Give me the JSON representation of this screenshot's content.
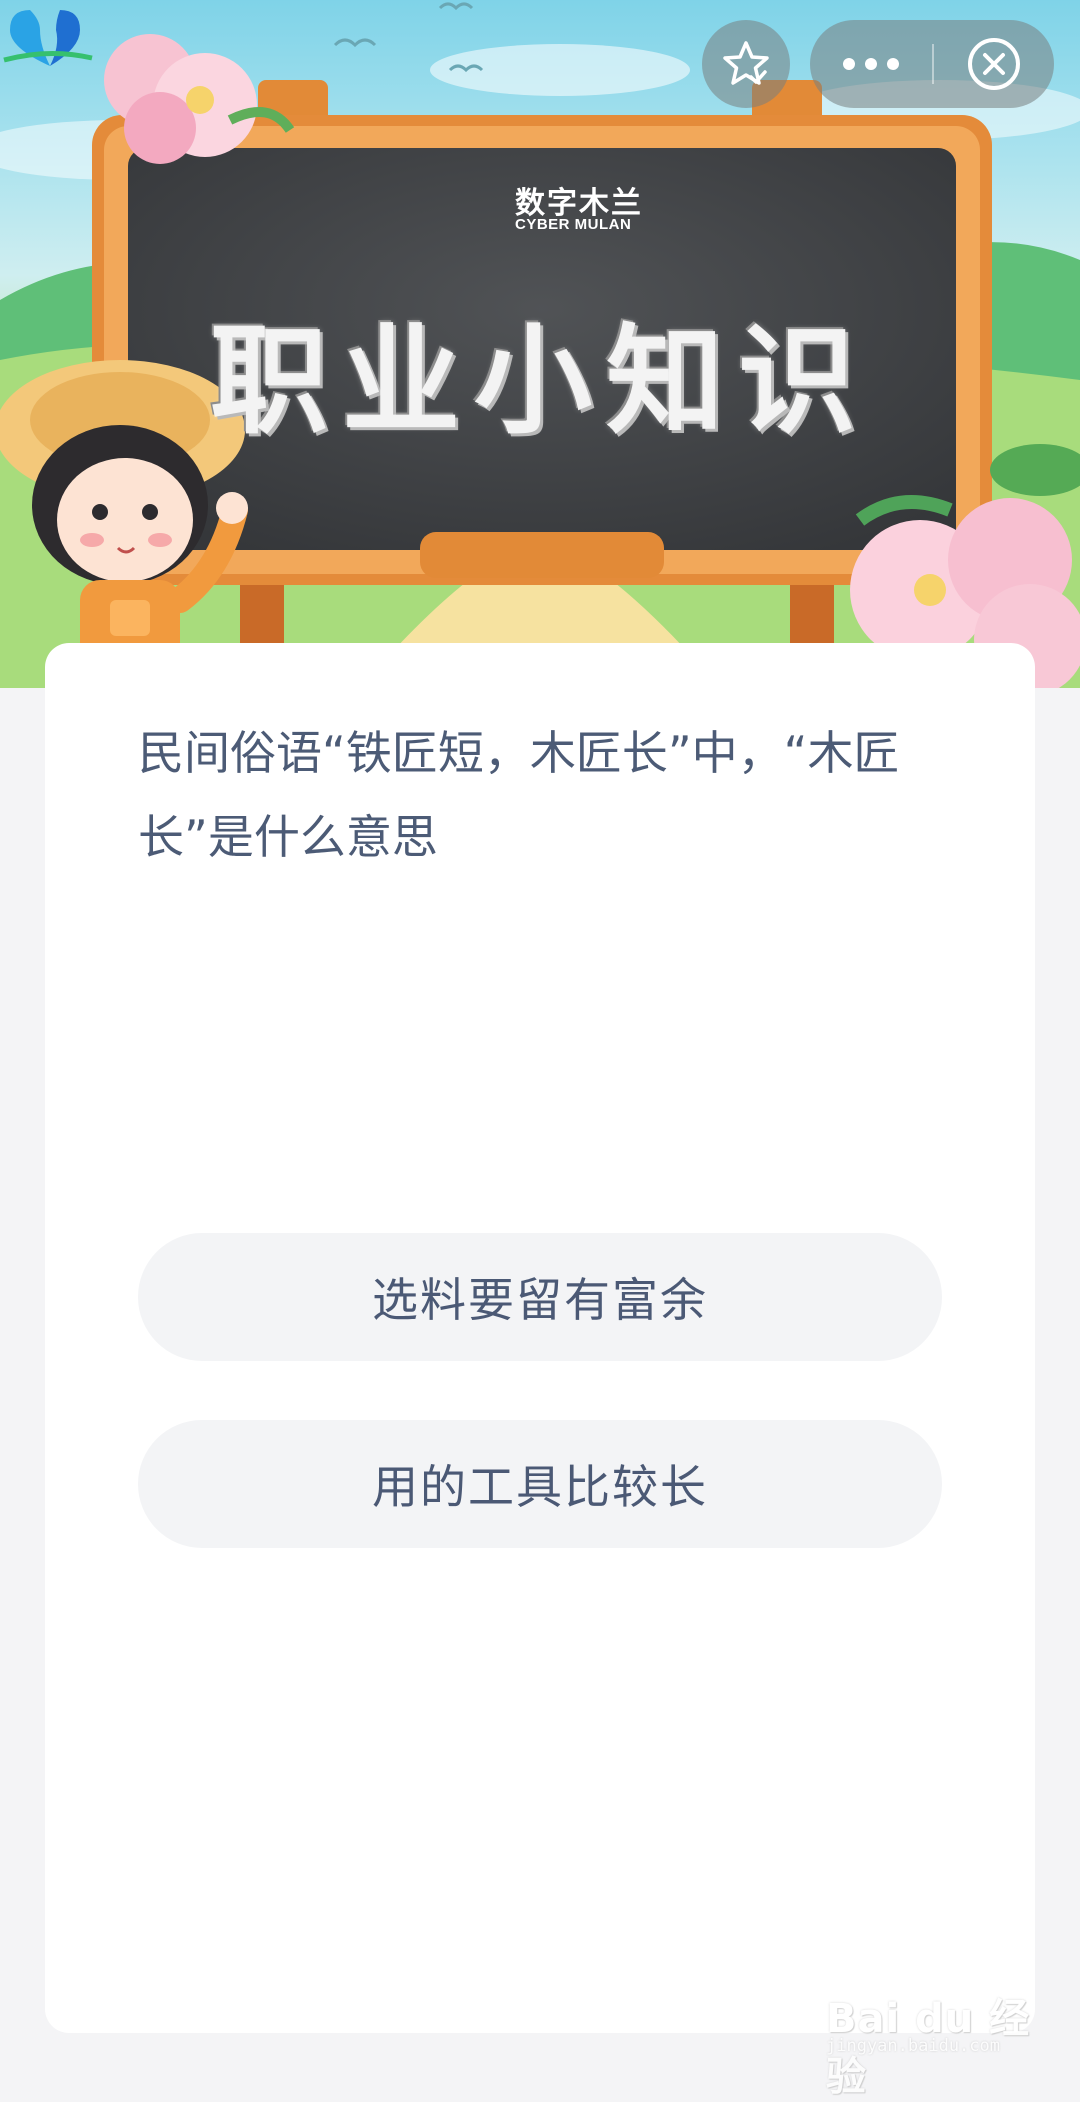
{
  "banner": {
    "logo_text": "数字木兰",
    "logo_subtext": "CYBER MULAN",
    "board_title": "职业小知识"
  },
  "nav": {
    "favorite_icon": "star-check-icon",
    "more_icon": "more-dots-icon",
    "close_icon": "close-circle-icon"
  },
  "quiz": {
    "question": "民间俗语“铁匠短，木匠长”中，“木匠长”是什么意思",
    "options": [
      {
        "label": "选料要留有富余"
      },
      {
        "label": "用的工具比较长"
      }
    ]
  },
  "watermark": {
    "text": "Bai du 经验",
    "url": "jingyan.baidu.com"
  },
  "colors": {
    "question_text": "#4c5b76",
    "option_bg": "#f3f4f6",
    "page_bg": "#f4f4f6",
    "card_bg": "#ffffff"
  }
}
